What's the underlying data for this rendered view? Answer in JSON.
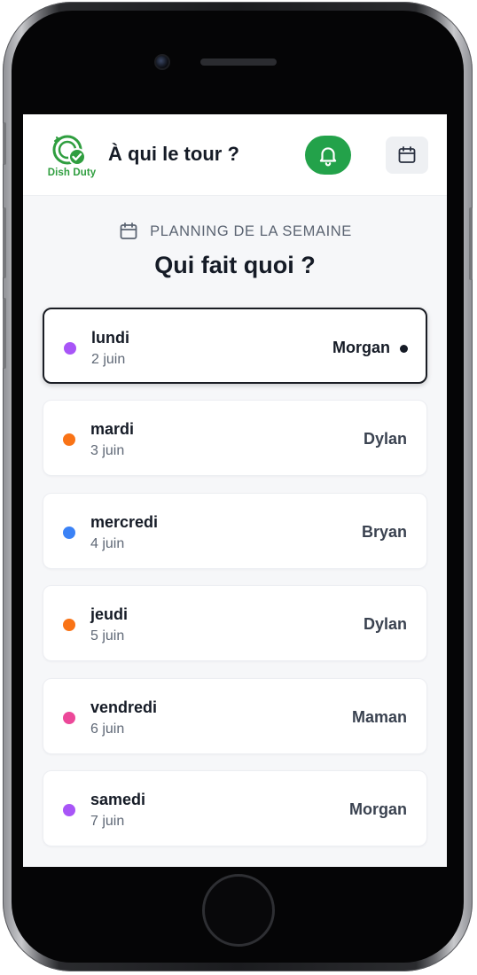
{
  "app": {
    "logo_text": "Dish Duty",
    "title": "À qui le tour ?"
  },
  "header": {
    "bell_icon": "bell-icon",
    "calendar_icon": "calendar-icon",
    "accent_color": "#23a24a"
  },
  "schedule": {
    "label": "PLANNING DE LA SEMAINE",
    "title": "Qui fait quoi ?",
    "days": [
      {
        "day": "lundi",
        "date": "2 juin",
        "person": "Morgan",
        "color": "#a855f7",
        "active": true
      },
      {
        "day": "mardi",
        "date": "3 juin",
        "person": "Dylan",
        "color": "#f97316",
        "active": false
      },
      {
        "day": "mercredi",
        "date": "4 juin",
        "person": "Bryan",
        "color": "#3b82f6",
        "active": false
      },
      {
        "day": "jeudi",
        "date": "5 juin",
        "person": "Dylan",
        "color": "#f97316",
        "active": false
      },
      {
        "day": "vendredi",
        "date": "6 juin",
        "person": "Maman",
        "color": "#ec4899",
        "active": false
      },
      {
        "day": "samedi",
        "date": "7 juin",
        "person": "Morgan",
        "color": "#a855f7",
        "active": false
      }
    ]
  }
}
